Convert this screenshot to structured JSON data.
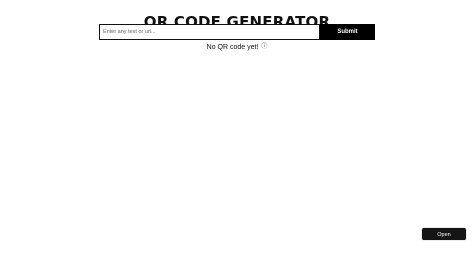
{
  "header": {
    "title": "QR CODE GENERATOR"
  },
  "form": {
    "input_value": "",
    "input_placeholder": "Enter any text or url...",
    "submit_label": "Submit"
  },
  "status": {
    "message": "No QR code yet!",
    "icon": "info-icon"
  },
  "sandbox": {
    "button_label": "Open Sandbox"
  },
  "colors": {
    "background": "#ffffff",
    "accent": "#000000",
    "text": "#111111"
  }
}
